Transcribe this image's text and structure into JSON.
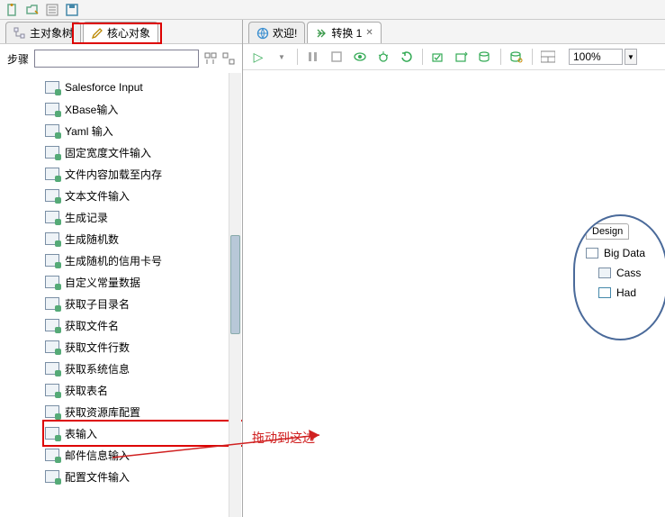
{
  "topbar_icons": [
    "new-file",
    "open-file",
    "list",
    "save"
  ],
  "left_tabs": [
    {
      "label": "主对象树",
      "icon": "tree-icon"
    },
    {
      "label": "核心对象",
      "icon": "pencil-icon",
      "active": true
    }
  ],
  "filter": {
    "label": "步骤",
    "value": "",
    "expand_icon": "expand-all-icon",
    "collapse_icon": "collapse-all-icon"
  },
  "tree_items": [
    "Salesforce Input",
    "XBase输入",
    "Yaml 输入",
    "固定宽度文件输入",
    "文件内容加载至内存",
    "文本文件输入",
    "生成记录",
    "生成随机数",
    "生成随机的信用卡号",
    "自定义常量数据",
    "获取子目录名",
    "获取文件名",
    "获取文件行数",
    "获取系统信息",
    "获取表名",
    "获取资源库配置",
    "表输入",
    "邮件信息输入",
    "配置文件输入"
  ],
  "selected_tree_index": 16,
  "right_tabs": [
    {
      "label": "欢迎!",
      "icon": "globe-icon"
    },
    {
      "label": "转换 1",
      "icon": "transform-icon",
      "close": "✕",
      "active": true
    }
  ],
  "right_toolbar_icons": [
    "play",
    "pause",
    "stop",
    "preview",
    "debug",
    "replay",
    "sql",
    "analyze-impact",
    "analyze-db",
    "layout"
  ],
  "zoom": {
    "value": "100%"
  },
  "annotation_text": "拖动到这边",
  "palette": {
    "tab": "Design",
    "items": [
      {
        "icon": "folder-icon",
        "label": "Big Data"
      },
      {
        "icon": "db-icon",
        "label": "Cass"
      },
      {
        "icon": "h-icon",
        "label": "Had"
      }
    ]
  }
}
